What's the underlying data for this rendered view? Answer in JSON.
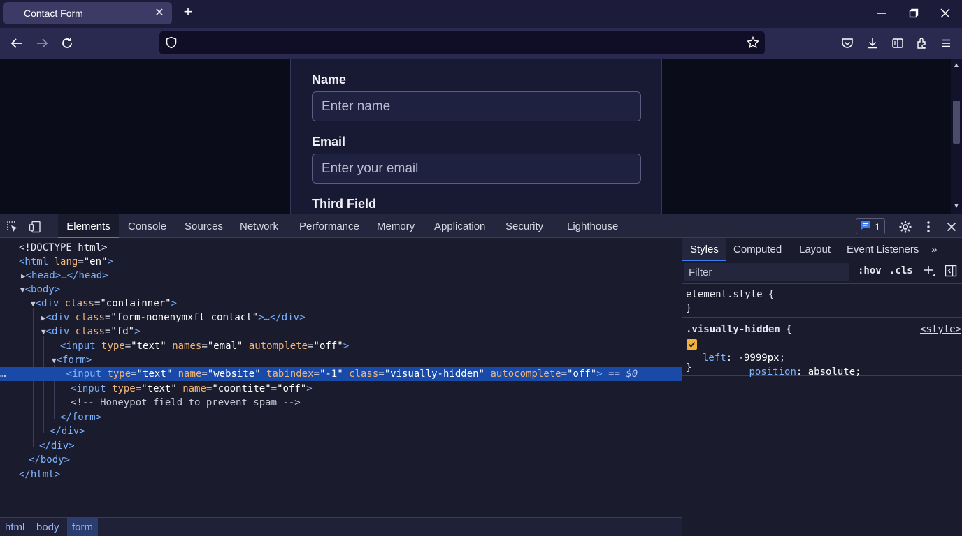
{
  "browser": {
    "tab_title": "Contact Form",
    "tab_close": "✕",
    "new_tab": "+",
    "url": ""
  },
  "form": {
    "fields": [
      {
        "label": "Name",
        "placeholder": "Enter name"
      },
      {
        "label": "Email",
        "placeholder": "Enter your email"
      },
      {
        "label": "Third Field"
      }
    ]
  },
  "devtools": {
    "tabs": [
      "Elements",
      "Console",
      "Sources",
      "Network",
      "Performance",
      "Memory",
      "Application",
      "Security",
      "Lighthouse"
    ],
    "active_tab": "Elements",
    "issues_count": "1",
    "dom": {
      "l0": "<!DOCTYPE html>",
      "l1_tag": "<html",
      "l1_attr": "lang",
      "l1_val": "\"en\"",
      "l1_close": ">",
      "l2_tri": "▶",
      "l2": "<head>…</head>",
      "l3_tri": "▼",
      "l3": "<body>",
      "l4_tri": "▼",
      "l4_tag": "<div",
      "l4_attr": "class",
      "l4_val": "\"containner\"",
      "l4_close": ">",
      "l5_tri": "▶",
      "l5_tag": "<div",
      "l5_attr": "class",
      "l5_val": "\"form-nonenymxft contact\"",
      "l5_close": ">…</div>",
      "l6_tri": "▼",
      "l6_tag": "<div",
      "l6_attr": "class",
      "l6_val": "\"fd\"",
      "l6_close": ">",
      "l7_tag": "<input",
      "l7_a1": "type",
      "l7_v1": "\"text\"",
      "l7_a2": "names",
      "l7_v2": "\"emal\"",
      "l7_a3": "automplete",
      "l7_v3": "\"off\"",
      "l7_close": ">",
      "l8_tri": "▼",
      "l8": "<form>",
      "l9_dots": "…",
      "l9_tag": "<input",
      "l9_a1": "type",
      "l9_v1": "\"text\"",
      "l9_a2": "name",
      "l9_v2": "\"website\"",
      "l9_a3": "tabindex",
      "l9_v3": "\"-1\"",
      "l9_a4": "class",
      "l9_v4": "\"visually-hidden\"",
      "l9_a5": "autocomplete",
      "l9_v5": "\"off\"",
      "l9_close": ">",
      "l9_marker": "== $0",
      "l10_tag": "<input",
      "l10_a1": "type",
      "l10_v1": "\"text\"",
      "l10_a2": "name",
      "l10_v2": "\"coontite\"",
      "l10_a3": "=",
      "l10_v3": "\"off\"",
      "l10_close": ">",
      "l11": "<!-- Honeypot field to prevent spam -->",
      "l12": "</form>",
      "l13": "</div>",
      "l14": "</div>",
      "l15": "</body>",
      "l16": "</html>"
    },
    "breadcrumbs": [
      "html",
      "body",
      "form"
    ],
    "styles": {
      "tabs": [
        "Styles",
        "Computed",
        "Layout",
        "Event Listeners"
      ],
      "more": "»",
      "filter_placeholder": "Filter",
      "hov": ":hov",
      "cls": ".cls",
      "element_style": "element.style {",
      "brace_close": "}",
      "rule_selector": ".visually-hidden {",
      "rule_source": "<style>",
      "decl1_prop": "position",
      "decl1_val": "absolute;",
      "decl2_prop": "left",
      "decl2_val": "-9999px;"
    }
  },
  "colors": {
    "accent": "#3d7bf0",
    "tag": "#7db3ff",
    "attr": "#f0b679",
    "selected_row": "#1a4aa8",
    "checkbox": "#f0b23a"
  }
}
